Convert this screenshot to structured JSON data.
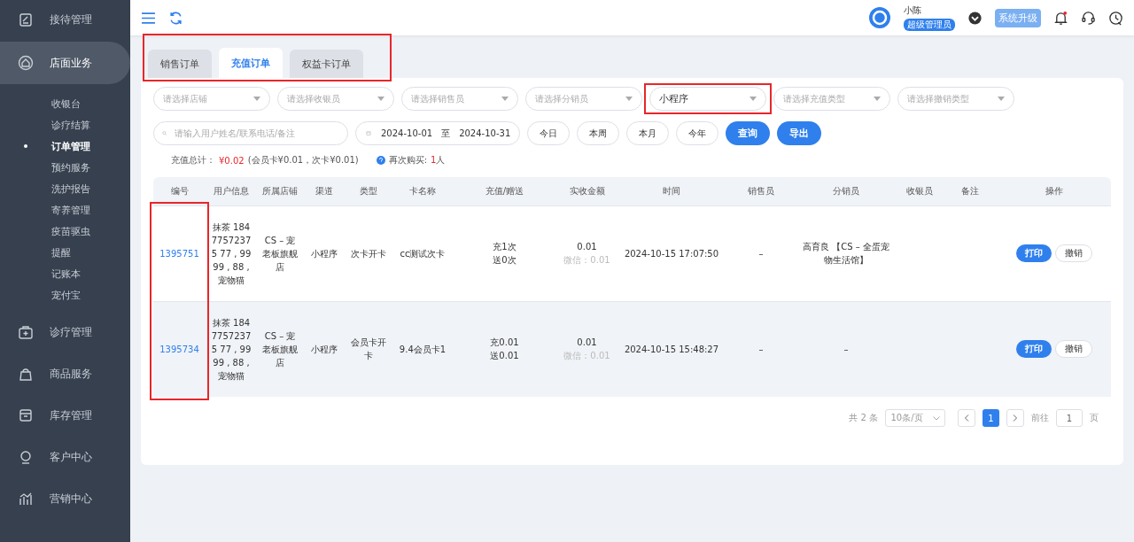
{
  "sidebar": {
    "items": [
      {
        "label": "接待管理",
        "selected": false
      },
      {
        "label": "店面业务",
        "selected": true,
        "expanded": true,
        "children": [
          {
            "label": "收银台",
            "selected": false
          },
          {
            "label": "诊疗结算",
            "selected": false
          },
          {
            "label": "订单管理",
            "selected": true
          },
          {
            "label": "预约服务",
            "selected": false
          },
          {
            "label": "洗护报告",
            "selected": false
          },
          {
            "label": "寄养管理",
            "selected": false
          },
          {
            "label": "疫苗驱虫",
            "selected": false
          },
          {
            "label": "提醒",
            "selected": false
          },
          {
            "label": "记账本",
            "selected": false
          },
          {
            "label": "宠付宝",
            "selected": false
          }
        ]
      },
      {
        "label": "诊疗管理",
        "selected": false
      },
      {
        "label": "商品服务",
        "selected": false
      },
      {
        "label": "库存管理",
        "selected": false
      },
      {
        "label": "客户中心",
        "selected": false
      },
      {
        "label": "营销中心",
        "selected": false
      }
    ]
  },
  "topbar": {
    "user": {
      "name": "小陈",
      "role": "超级管理员"
    },
    "upgrade": "系统升级",
    "has_notification": true
  },
  "tabs": {
    "highlighted": true,
    "items": [
      {
        "label": "销售订单",
        "selected": false
      },
      {
        "label": "充值订单",
        "selected": true
      },
      {
        "label": "权益卡订单",
        "selected": false
      }
    ]
  },
  "filters": {
    "selects": [
      {
        "placeholder": "请选择店铺"
      },
      {
        "placeholder": "请选择收银员"
      },
      {
        "placeholder": "请选择销售员"
      },
      {
        "placeholder": "请选择分销员"
      },
      {
        "value": "小程序",
        "highlighted": true
      },
      {
        "placeholder": "请选择充值类型"
      },
      {
        "placeholder": "请选择撤销类型"
      }
    ],
    "search": {
      "placeholder": "请输入用户姓名/联系电话/备注"
    },
    "date_range": {
      "start": "2024-10-01",
      "separator": "至",
      "end": "2024-10-31"
    },
    "quick_ranges": [
      "今日",
      "本周",
      "本月",
      "今年"
    ],
    "buttons": [
      {
        "label": "查询",
        "kind": "primary"
      },
      {
        "label": "导出",
        "kind": "primary"
      }
    ]
  },
  "summary": {
    "label": "充值总计：",
    "total": "¥0.02",
    "detail": "(会员卡¥0.01，次卡¥0.01)",
    "repeat_label": "再次购买:",
    "repeat_count": "1",
    "repeat_unit": "人"
  },
  "table": {
    "columns": [
      {
        "label": "编号",
        "highlighted": true
      },
      {
        "label": "用户信息"
      },
      {
        "label": "所属店铺"
      },
      {
        "label": "渠道"
      },
      {
        "label": "类型"
      },
      {
        "label": "卡名称"
      },
      {
        "label": "充值/赠送"
      },
      {
        "label": "实收金额"
      },
      {
        "label": "时间"
      },
      {
        "label": "销售员"
      },
      {
        "label": "分销员"
      },
      {
        "label": "收银员"
      },
      {
        "label": "备注"
      },
      {
        "label": "操作"
      }
    ],
    "rows": [
      {
        "hovered": false,
        "id": "1395751",
        "user": "抹茶 18477572375 77 , 9999 , 88 , 宠物猫",
        "store": "CS – 宠老板旗舰店",
        "channel": "小程序",
        "type": "次卡开卡",
        "card": "cc测试次卡",
        "recharge": [
          "充1次",
          "送0次"
        ],
        "amount": "0.01",
        "payment": "微信：0.01",
        "time": "2024-10-15 17:07:50",
        "sales": "–",
        "distributor": "高育良 【CS – 全蛋宠物生活馆】",
        "actions": [
          {
            "label": "打印",
            "kind": "primary"
          },
          {
            "label": "撤销",
            "kind": "plain"
          }
        ]
      },
      {
        "hovered": true,
        "id": "1395734",
        "user": "抹茶 18477572375 77 , 9999 , 88 , 宠物猫",
        "store": "CS – 宠老板旗舰店",
        "channel": "小程序",
        "type": "会员卡开卡",
        "card": "9.4会员卡1",
        "recharge": [
          "充0.01",
          "送0.01"
        ],
        "amount": "0.01",
        "payment": "微信：0.01",
        "time": "2024-10-15 15:48:27",
        "sales": "–",
        "distributor": "–",
        "actions": [
          {
            "label": "打印",
            "kind": "primary"
          },
          {
            "label": "撤销",
            "kind": "plain"
          }
        ]
      }
    ]
  },
  "pagination": {
    "total": "共 2 条",
    "page_size": "10条/页",
    "pages": [
      {
        "label": "1",
        "selected": true
      }
    ],
    "goto_label": "前往",
    "goto_value": "1",
    "goto_unit": "页"
  }
}
